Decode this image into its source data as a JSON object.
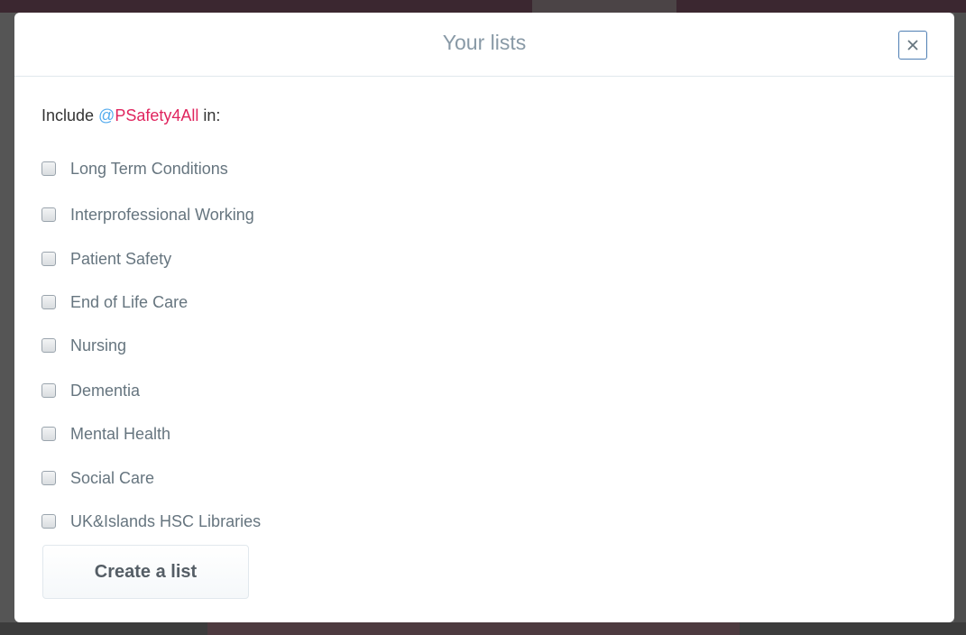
{
  "modal": {
    "title": "Your lists",
    "close_label": "×",
    "close_icon": "close-icon",
    "include": {
      "prefix": "Include ",
      "at_sign": "@",
      "handle": "PSafety4All",
      "suffix": " in:"
    },
    "lists": [
      {
        "label": "Long Term Conditions",
        "checked": false
      },
      {
        "label": "Interprofessional Working",
        "checked": false
      },
      {
        "label": "Patient Safety",
        "checked": false
      },
      {
        "label": "End of Life Care",
        "checked": false
      },
      {
        "label": "Nursing",
        "checked": false
      },
      {
        "label": "Dementia",
        "checked": false
      },
      {
        "label": "Mental Health",
        "checked": false
      },
      {
        "label": "Social Care",
        "checked": false
      },
      {
        "label": "UK&Islands HSC Libraries",
        "checked": false
      }
    ],
    "create_button_label": "Create a list"
  },
  "colors": {
    "title": "#8899a6",
    "handle": "#e0245e",
    "at_sign": "#55acee",
    "close_border": "#4f7fb4"
  }
}
